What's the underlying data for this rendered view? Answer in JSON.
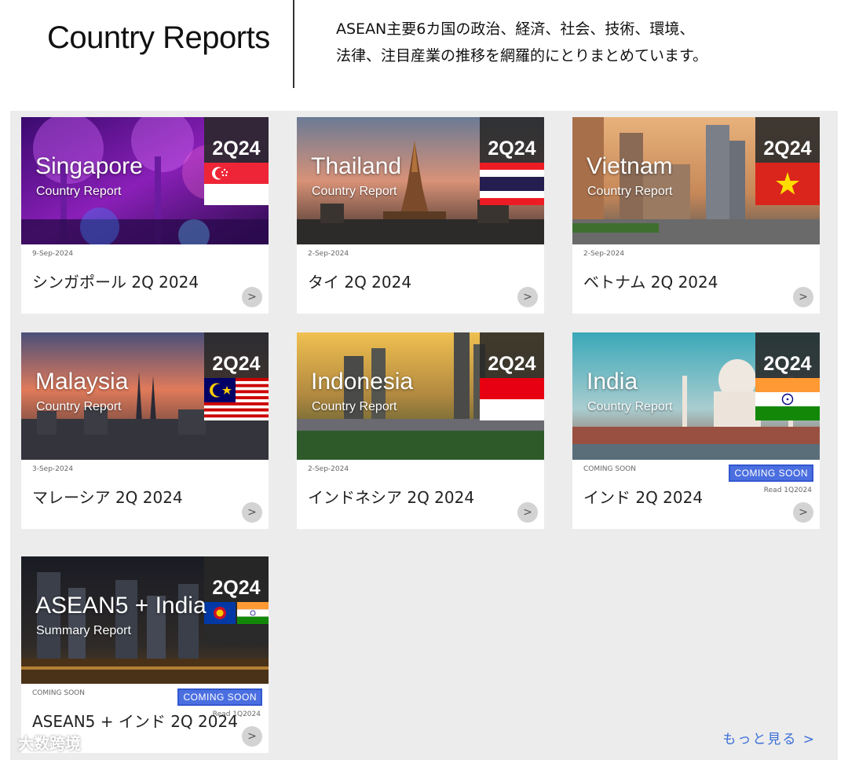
{
  "header": {
    "title": "Country Reports",
    "description_line1": "ASEAN主要6カ国の政治、経済、社会、技術、環境、",
    "description_line2": "法律、注目産業の推移を網羅的にとりまとめています。"
  },
  "cards": [
    {
      "country_label": "Singapore",
      "subtitle": "Country Report",
      "badge": "2Q24",
      "date": "9-Sep-2024",
      "title": "シンガポール 2Q 2024",
      "flag": "singapore-flag"
    },
    {
      "country_label": "Thailand",
      "subtitle": "Country Report",
      "badge": "2Q24",
      "date": "2-Sep-2024",
      "title": "タイ 2Q 2024",
      "flag": "thailand-flag"
    },
    {
      "country_label": "Vietnam",
      "subtitle": "Country Report",
      "badge": "2Q24",
      "date": "2-Sep-2024",
      "title": "ベトナム 2Q 2024",
      "flag": "vietnam-flag"
    },
    {
      "country_label": "Malaysia",
      "subtitle": "Country Report",
      "badge": "2Q24",
      "date": "3-Sep-2024",
      "title": "マレーシア 2Q 2024",
      "flag": "malaysia-flag"
    },
    {
      "country_label": "Indonesia",
      "subtitle": "Country Report",
      "badge": "2Q24",
      "date": "2-Sep-2024",
      "title": "インドネシア 2Q 2024",
      "flag": "indonesia-flag"
    },
    {
      "country_label": "India",
      "subtitle": "Country Report",
      "badge": "2Q24",
      "date": "COMING SOON",
      "title": "インド 2Q 2024",
      "flag": "india-flag",
      "soon_badge": "COMING SOON",
      "read_prev": "Read 1Q2024"
    },
    {
      "country_label": "ASEAN5 + India",
      "subtitle": "Summary Report",
      "badge": "2Q24",
      "date": "COMING SOON",
      "title": "ASEAN5 + インド 2Q 2024",
      "flag": "asean-india-flags",
      "soon_badge": "COMING SOON",
      "read_prev": "Read 1Q2024"
    }
  ],
  "arrow_glyph": ">",
  "more_link": "もっと見る >",
  "watermark": "大数跨境"
}
